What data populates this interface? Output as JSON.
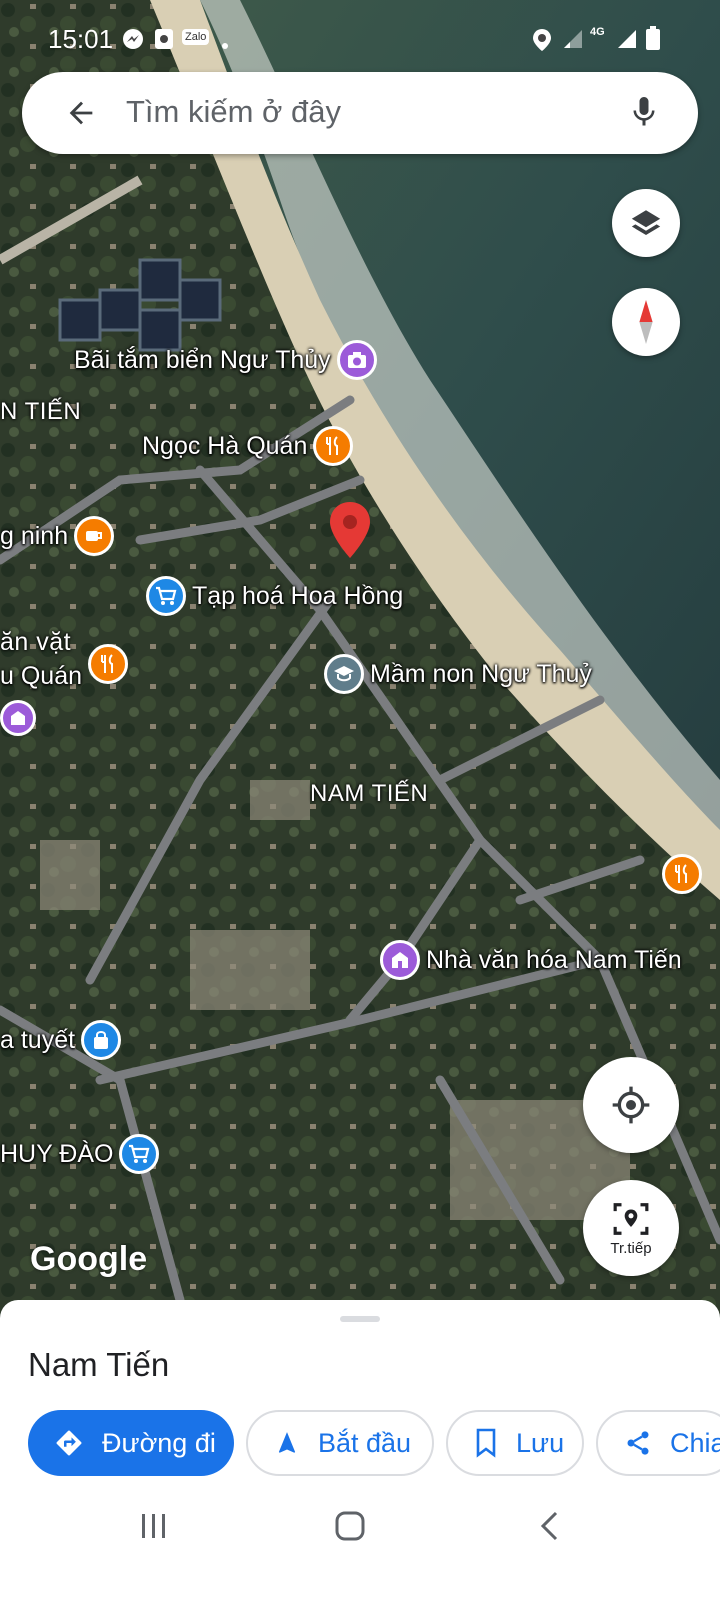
{
  "status_bar": {
    "time": "15:01",
    "network": "4G",
    "zalo": "Zalo"
  },
  "search": {
    "placeholder": "Tìm kiếm ở đây"
  },
  "map": {
    "labels": {
      "beach": "Bãi tắm biển Ngư Thủy",
      "nam_tien_left": "N TIẾN",
      "ngoc_ha": "Ngọc Hà Quán",
      "ninh": "g ninh",
      "tap_hoa": "Tạp hoá Hoa Hồng",
      "an_vat": "ăn vặt",
      "u_quan": "u Quán",
      "mam_non": "Mầm non Ngư Thuỷ",
      "nam_tien": "NAM TIẾN",
      "nha_van_hoa": "Nhà văn hóa Nam Tiến",
      "tuyet": "a tuyết",
      "huy_dao": "HUY ĐÀO"
    },
    "google_logo": "Google"
  },
  "fabs": {
    "street_view_label": "Tr.tiếp"
  },
  "sheet": {
    "place_name": "Nam Tiến",
    "actions": {
      "directions": "Đường đi",
      "start": "Bắt đầu",
      "save": "Lưu",
      "share": "Chia"
    }
  },
  "colors": {
    "accent": "#1a73e8",
    "food_pin": "#f57c00",
    "landmark_pin": "#9c5bd9",
    "shop_pin": "#1e88e5",
    "school_pin": "#607d8b",
    "marker": "#e53935"
  }
}
